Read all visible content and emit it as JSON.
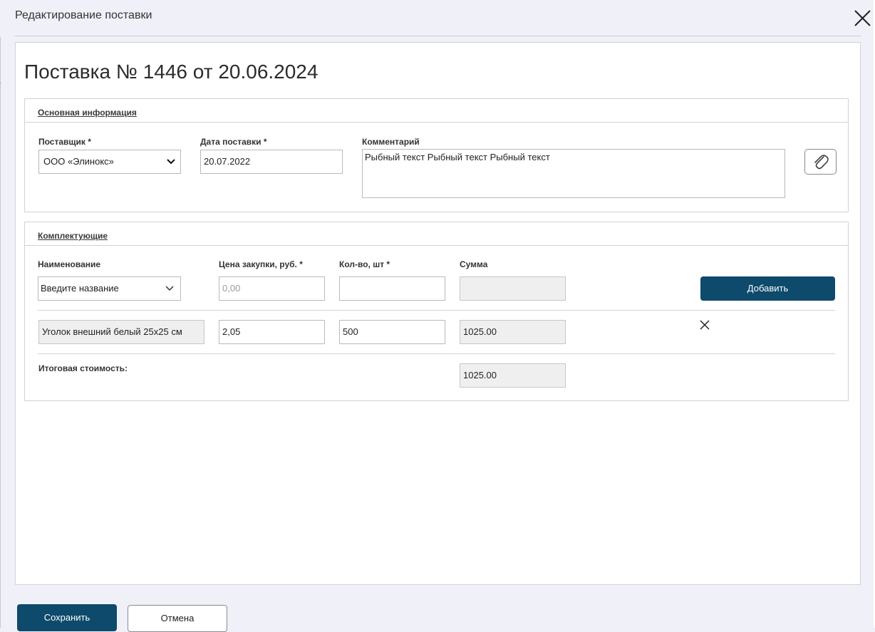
{
  "modal": {
    "title": "Редактирование поставки"
  },
  "document": {
    "title": "Поставка № 1446 от 20.06.2024"
  },
  "main_info": {
    "section_title": "Основная информация",
    "supplier_label": "Поставщик *",
    "supplier_value": "ООО «Элинокс»",
    "date_label": "Дата поставки *",
    "date_value": "20.07.2022",
    "comment_label": "Комментарий",
    "comment_value": "Рыбный текст Рыбный текст Рыбный текст",
    "attach_icon": "paperclip-icon"
  },
  "components": {
    "section_title": "Комплектующие",
    "columns": {
      "name": "Наименование",
      "price": "Цена закупки, руб. *",
      "qty": "Кол-во, шт *",
      "sum": "Сумма"
    },
    "new_row": {
      "name_placeholder": "Введите название",
      "price_placeholder": "0,00",
      "qty_value": "",
      "sum_value": ""
    },
    "add_button": "Добавить",
    "rows": [
      {
        "name": "Уголок внешний белый 25х25 см",
        "price": "2,05",
        "qty": "500",
        "sum": "1025.00"
      }
    ],
    "total_label": "Итоговая стоимость:",
    "total_value": "1025.00"
  },
  "footer": {
    "save_button": "Сохранить",
    "cancel_button": "Отмена"
  },
  "colors": {
    "primary": "#0d4a6b",
    "background": "#f0f0f8",
    "readonly_field": "#efefef"
  }
}
